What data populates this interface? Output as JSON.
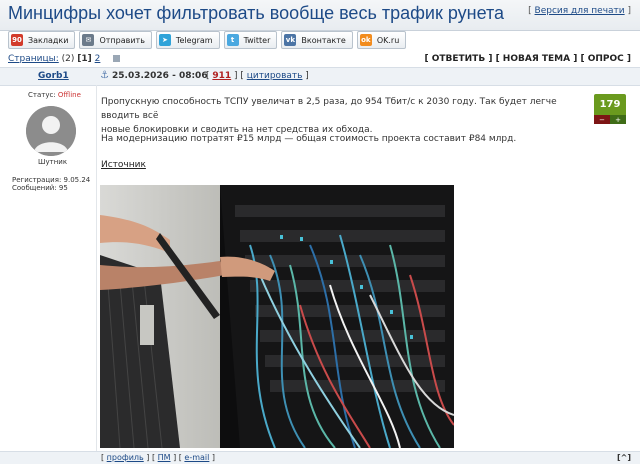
{
  "header": {
    "title": "Минцифры хочет фильтровать вообще весь трафик рунета",
    "print_link": "Версия для печати"
  },
  "share": [
    {
      "label": "Закладки",
      "icon": "bookmarks-icon",
      "color": "#d23a2a",
      "glyph": "90"
    },
    {
      "label": "Отправить",
      "icon": "mail-icon",
      "color": "#6b7a8a",
      "glyph": "✉"
    },
    {
      "label": "Telegram",
      "icon": "telegram-icon",
      "color": "#2fa3d9",
      "glyph": "➤"
    },
    {
      "label": "Twitter",
      "icon": "twitter-icon",
      "color": "#4aa8e0",
      "glyph": "t"
    },
    {
      "label": "Вконтакте",
      "icon": "vk-icon",
      "color": "#4b74a5",
      "glyph": "vk"
    },
    {
      "label": "OK.ru",
      "icon": "ok-icon",
      "color": "#f28c1e",
      "glyph": "ok"
    }
  ],
  "pagination": {
    "label": "Страницы:",
    "total": "(2)",
    "current": "[1]",
    "next": "2"
  },
  "actions": "[ ОТВЕТИТЬ ] [ НОВАЯ ТЕМА ] [ ОПРОС ]",
  "post": {
    "author": "Gorb1",
    "date": "25.03.2026 - 08:06",
    "number": "911",
    "quote_link": "цитировать",
    "status_label": "Статус:",
    "status_value": "Offline",
    "rank": "Шутник",
    "registered": "Регистрация: 9.05.24",
    "messages": "Сообщений: 95",
    "paragraph1_line1": "Пропускную способность ТСПУ увеличат в 2,5 раза, до 954 Тбит/с к 2030 году. Так будет легче вводить всё",
    "paragraph1_line2": "новые блокировки и сводить на нет средства их обхода.",
    "paragraph2": "На модернизацию потратят ₽15 млрд — общая стоимость проекта составит ₽84 млрд.",
    "source_link": "Источник",
    "rating": "179",
    "rating_minus": "−",
    "rating_plus": "+"
  },
  "footer": {
    "profile": "профиль",
    "pm": "ПМ",
    "email": "e-mail",
    "to_top": "[^]"
  }
}
